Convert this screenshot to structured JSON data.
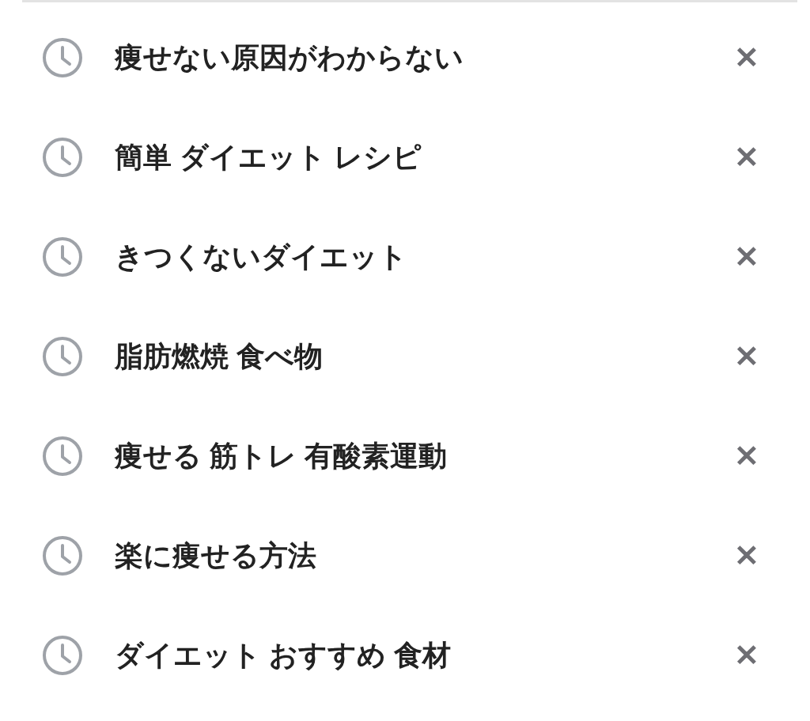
{
  "history": [
    {
      "query": "痩せない原因がわからない",
      "remove": "✕"
    },
    {
      "query": "簡単 ダイエット レシピ",
      "remove": "✕"
    },
    {
      "query": "きつくないダイエット",
      "remove": "✕"
    },
    {
      "query": "脂肪燃焼 食べ物",
      "remove": "✕"
    },
    {
      "query": "痩せる 筋トレ 有酸素運動",
      "remove": "✕"
    },
    {
      "query": "楽に痩せる方法",
      "remove": "✕"
    },
    {
      "query": "ダイエット おすすめ 食材",
      "remove": "✕"
    }
  ]
}
